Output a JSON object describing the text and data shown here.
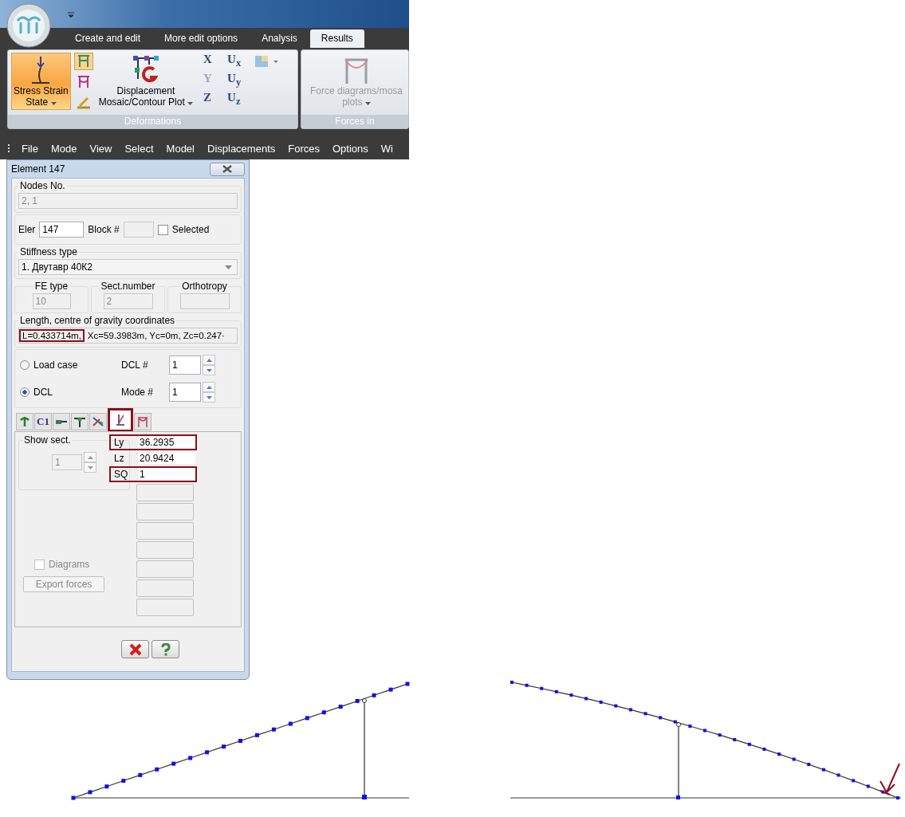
{
  "ribbon_tabs": [
    {
      "label": "Create and edit",
      "selected": false
    },
    {
      "label": "More edit options",
      "selected": false
    },
    {
      "label": "Analysis",
      "selected": false
    },
    {
      "label": "Results",
      "selected": true
    }
  ],
  "ribbon_groups": [
    {
      "title": "Deformations",
      "big_buttons": [
        {
          "kind": "stress",
          "line1": "Stress Strain",
          "line2": "State",
          "selected": true
        },
        {
          "kind": "displacement",
          "line1": "Displacement",
          "line2": "Mosaic/Contour Plot",
          "selected": false
        }
      ],
      "axis_buttons": [
        {
          "label": "X",
          "disabled": false
        },
        {
          "label": "Y",
          "disabled": true
        },
        {
          "label": "Z",
          "disabled": false
        },
        {
          "label": "U$_{x}$",
          "disabled": false
        },
        {
          "label": "U$_{y}$",
          "disabled": false
        },
        {
          "label": "U$_{z}$",
          "disabled": false
        }
      ]
    },
    {
      "title": "Forces in",
      "big_buttons": [
        {
          "kind": "forces",
          "line1": "Force diagrams/mosa",
          "line2": "plots",
          "selected": false
        }
      ]
    }
  ],
  "menu": [
    "File",
    "Mode",
    "View",
    "Select",
    "Model",
    "Displacements",
    "Forces",
    "Options",
    "Wi"
  ],
  "dialog": {
    "title": "Element 147",
    "nodes": {
      "legend": "Nodes No.",
      "value": "2, 1"
    },
    "element": {
      "label": "Eler",
      "value": "147",
      "block_label": "Block #",
      "selected_label": "Selected",
      "checked": false
    },
    "stiffness": {
      "legend": "Stiffness type",
      "value": "1. Двутавр 40К2"
    },
    "fe_type": {
      "legend": "FE type",
      "value": "10"
    },
    "sect_number": {
      "legend": "Sect.number",
      "value": "2"
    },
    "orthotropy": {
      "legend": "Orthotropy"
    },
    "length": {
      "legend": "Length, centre of gravity coordinates",
      "parts": [
        {
          "text": "L=0.433714m,",
          "highlighted": true
        },
        {
          "text": "Xc=59.3983m, Yc=0m, Zc=0.247·",
          "highlighted": false
        }
      ]
    },
    "source": [
      {
        "label": "Load case",
        "selected": false,
        "field_label": "DCL #",
        "value": "1"
      },
      {
        "label": "DCL",
        "selected": true,
        "field_label": "Mode #",
        "value": "1"
      }
    ],
    "icon_tabs": [
      {
        "kind": "rotate",
        "selected": false,
        "highlighted": false
      },
      {
        "kind": "text",
        "label": "C1",
        "selected": false,
        "highlighted": false
      },
      {
        "kind": "beam",
        "selected": false,
        "highlighted": false
      },
      {
        "kind": "node",
        "selected": false,
        "highlighted": false
      },
      {
        "kind": "axes",
        "selected": false,
        "highlighted": false
      },
      {
        "kind": "support",
        "selected": true,
        "highlighted": true
      },
      {
        "kind": "frame",
        "selected": false,
        "highlighted": false
      }
    ],
    "show_sect": {
      "legend": "Show sect.",
      "value": "1"
    },
    "params": [
      {
        "name": "Ly",
        "value": "36.2935",
        "highlighted": true
      },
      {
        "name": "Lz",
        "value": "20.9424",
        "highlighted": false
      },
      {
        "name": "SQ",
        "value": "1",
        "highlighted": true
      }
    ],
    "diagrams": {
      "label": "Diagrams",
      "checked": false
    },
    "export_button": "Export forces"
  }
}
